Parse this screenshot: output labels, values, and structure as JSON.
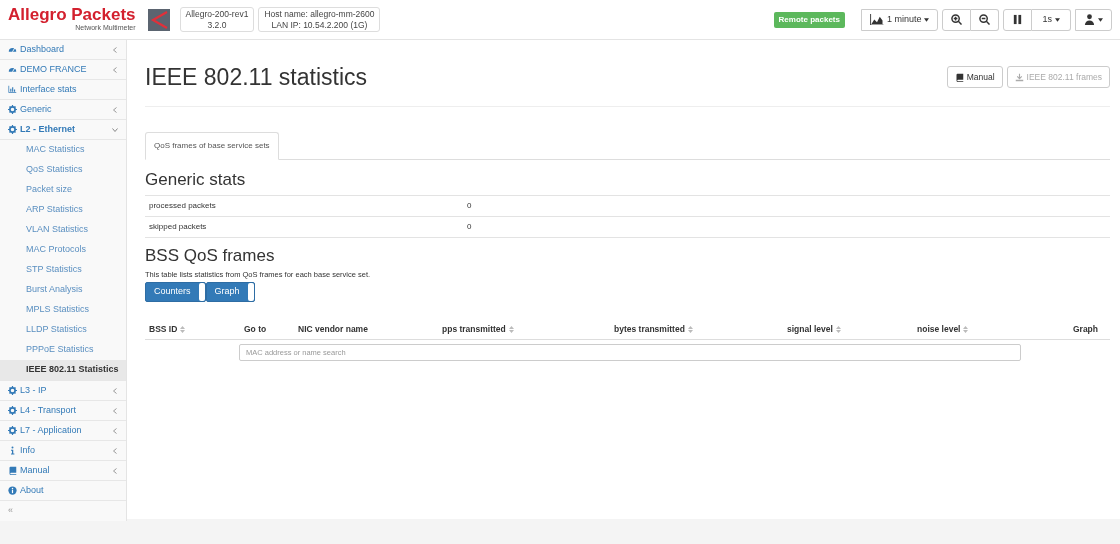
{
  "brand": {
    "name": "Allegro Packets",
    "subtitle": "Network Multimeter"
  },
  "device": {
    "model": "Allegro-200-rev1",
    "version": "3.2.0",
    "host": "Host name: allegro-mm-2600",
    "lan": "LAN IP: 10.54.2.200 (1G)"
  },
  "status_badge": "Remote packets",
  "toolbar": [
    {
      "kind": "range",
      "label": "1 minute"
    },
    {
      "kind": "zoom-in"
    },
    {
      "kind": "zoom-out"
    },
    {
      "kind": "pause"
    },
    {
      "kind": "interval",
      "label": "1s"
    },
    {
      "kind": "user"
    }
  ],
  "sidebar": {
    "items": [
      {
        "kind": "dashboard",
        "label": "Dashboard",
        "expanded": false
      },
      {
        "kind": "dashboard",
        "label": "DEMO FRANCE",
        "expanded": false
      },
      {
        "kind": "chart",
        "label": "Interface stats"
      },
      {
        "kind": "gear",
        "label": "Generic",
        "expanded": false
      },
      {
        "kind": "gear",
        "label": "L2 - Ethernet",
        "expanded": true,
        "children": [
          {
            "label": "MAC Statistics",
            "selected": false
          },
          {
            "label": "QoS Statistics",
            "selected": false
          },
          {
            "label": "Packet size",
            "selected": false
          },
          {
            "label": "ARP Statistics",
            "selected": false
          },
          {
            "label": "VLAN Statistics",
            "selected": false
          },
          {
            "label": "MAC Protocols",
            "selected": false
          },
          {
            "label": "STP Statistics",
            "selected": false
          },
          {
            "label": "Burst Analysis",
            "selected": false
          },
          {
            "label": "MPLS Statistics",
            "selected": false
          },
          {
            "label": "LLDP Statistics",
            "selected": false
          },
          {
            "label": "PPPoE Statistics",
            "selected": false
          },
          {
            "label": "IEEE 802.11 Statistics",
            "selected": true
          }
        ]
      },
      {
        "kind": "gear",
        "label": "L3 - IP",
        "expanded": false
      },
      {
        "kind": "gear",
        "label": "L4 - Transport",
        "expanded": false
      },
      {
        "kind": "gear",
        "label": "L7 - Application",
        "expanded": false
      },
      {
        "kind": "info",
        "label": "Info",
        "expanded": false
      },
      {
        "kind": "book",
        "label": "Manual",
        "expanded": false
      },
      {
        "kind": "info-circle",
        "label": "About"
      }
    ],
    "collapse": "«"
  },
  "page": {
    "title": "IEEE 802.11 statistics",
    "actions": [
      {
        "kind": "book",
        "label": "Manual",
        "disabled": false
      },
      {
        "kind": "download",
        "label": "IEEE 802.11 frames",
        "disabled": true
      }
    ]
  },
  "tabs": [
    {
      "label": "QoS frames of base service sets",
      "selected": true
    }
  ],
  "generic_stats": {
    "title": "Generic stats",
    "rows": [
      {
        "label": "processed packets",
        "value": "0"
      },
      {
        "label": "skipped packets",
        "value": "0"
      }
    ]
  },
  "bss": {
    "title": "BSS QoS frames",
    "description": "This table lists statistics from QoS frames for each base service set.",
    "toggles": [
      {
        "label": "Counters",
        "on": true
      },
      {
        "label": "Graph",
        "on": true
      }
    ],
    "columns": [
      {
        "label": "BSS ID",
        "sortable": true
      },
      {
        "label": "Go to",
        "sortable": false
      },
      {
        "label": "NIC vendor name",
        "sortable": false
      },
      {
        "label": "pps transmitted",
        "sortable": true
      },
      {
        "label": "bytes transmitted",
        "sortable": true
      },
      {
        "label": "signal level",
        "sortable": true
      },
      {
        "label": "noise level",
        "sortable": true
      },
      {
        "label": "Graph",
        "sortable": false
      }
    ],
    "search": {
      "placeholder": "MAC address or name search"
    }
  }
}
